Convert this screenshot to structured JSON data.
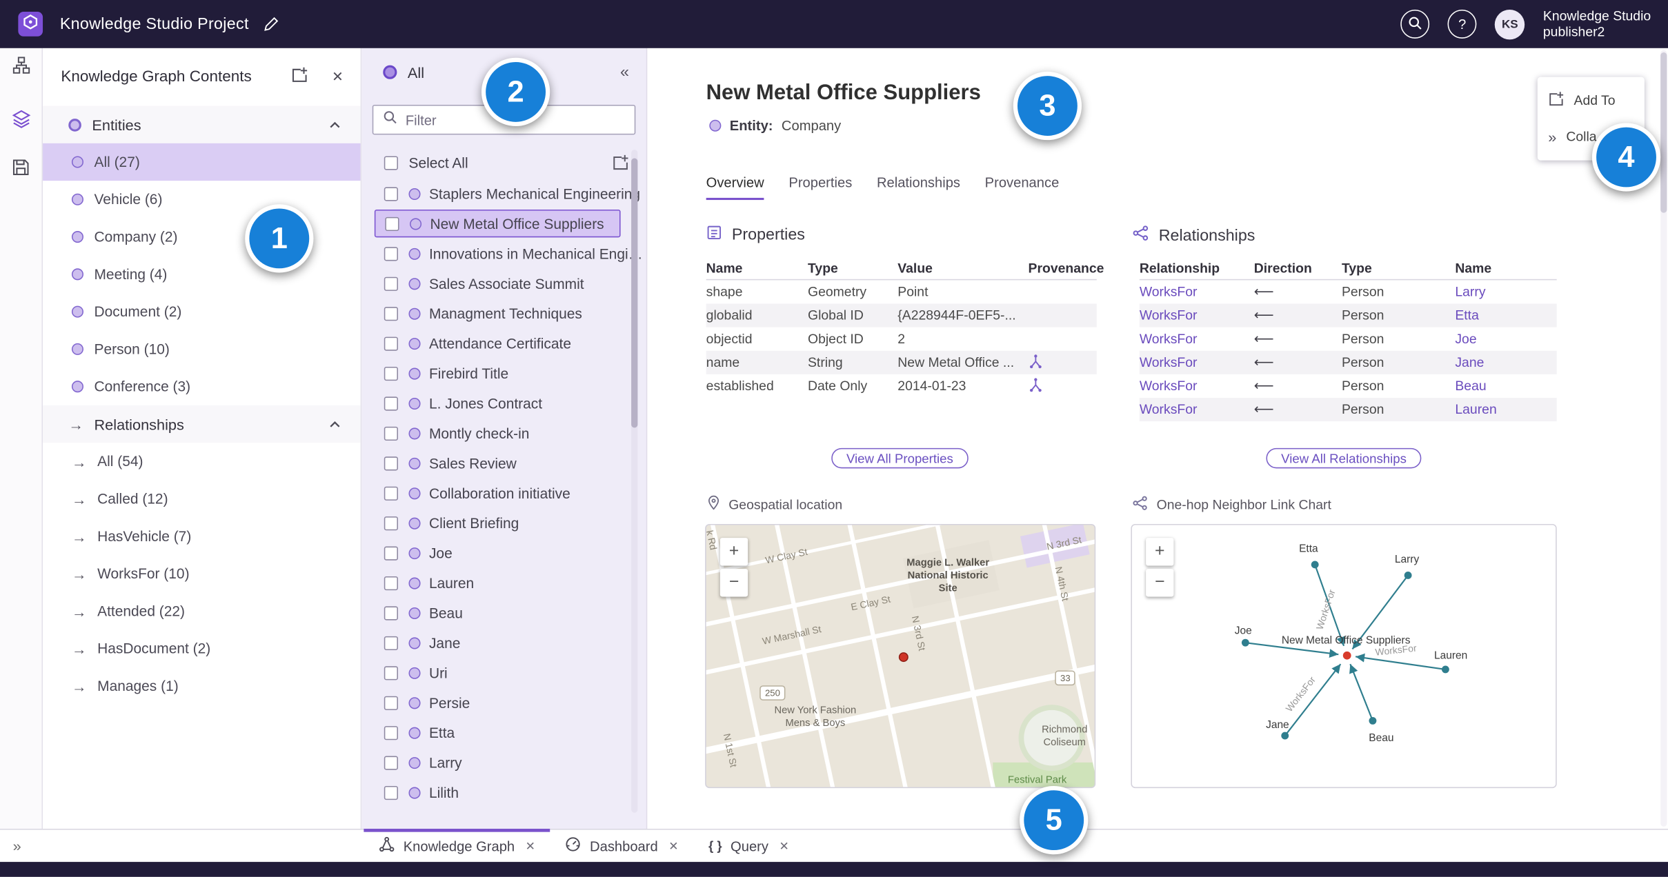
{
  "icons": {
    "close": "✕",
    "collapse_left": "«",
    "expand_right": "»",
    "question": "?",
    "braces": "{ }",
    "plus": "+",
    "minus": "−",
    "arrow_right": "→"
  },
  "topbar": {
    "title": "Knowledge Studio Project",
    "app_name": "Knowledge Studio",
    "user_name": "publisher2",
    "avatar_initials": "KS"
  },
  "contents_panel": {
    "title": "Knowledge Graph Contents",
    "entities": {
      "label": "Entities",
      "items": [
        {
          "label": "All (27)",
          "selected": true
        },
        {
          "label": "Vehicle (6)"
        },
        {
          "label": "Company (2)"
        },
        {
          "label": "Meeting (4)"
        },
        {
          "label": "Document (2)"
        },
        {
          "label": "Person (10)"
        },
        {
          "label": "Conference (3)"
        }
      ]
    },
    "relationships": {
      "label": "Relationships",
      "items": [
        {
          "label": "All (54)"
        },
        {
          "label": "Called (12)"
        },
        {
          "label": "HasVehicle (7)"
        },
        {
          "label": "WorksFor (10)"
        },
        {
          "label": "Attended (22)"
        },
        {
          "label": "HasDocument (2)"
        },
        {
          "label": "Manages (1)"
        }
      ]
    }
  },
  "list_panel": {
    "header": "All",
    "filter_placeholder": "Filter",
    "select_all_label": "Select All",
    "items": [
      {
        "label": "Staplers Mechanical Engineering"
      },
      {
        "label": "New Metal Office Suppliers",
        "selected": true
      },
      {
        "label": "Innovations in Mechanical Engin..."
      },
      {
        "label": "Sales Associate Summit"
      },
      {
        "label": "Managment Techniques"
      },
      {
        "label": "Attendance Certificate"
      },
      {
        "label": "Firebird Title"
      },
      {
        "label": "L. Jones Contract"
      },
      {
        "label": "Montly check-in"
      },
      {
        "label": "Sales Review"
      },
      {
        "label": "Collaboration initiative"
      },
      {
        "label": "Client Briefing"
      },
      {
        "label": "Joe"
      },
      {
        "label": "Lauren"
      },
      {
        "label": "Beau"
      },
      {
        "label": "Jane"
      },
      {
        "label": "Uri"
      },
      {
        "label": "Persie"
      },
      {
        "label": "Etta"
      },
      {
        "label": "Larry"
      },
      {
        "label": "Lilith"
      }
    ]
  },
  "detail": {
    "title": "New Metal Office Suppliers",
    "entity_label": "Entity:",
    "entity_type": "Company",
    "tabs": [
      {
        "label": "Overview",
        "active": true
      },
      {
        "label": "Properties"
      },
      {
        "label": "Relationships"
      },
      {
        "label": "Provenance"
      }
    ],
    "menu": {
      "add_to": "Add To",
      "collapse": "Colla"
    },
    "properties": {
      "heading": "Properties",
      "columns": [
        "Name",
        "Type",
        "Value",
        "Provenance"
      ],
      "rows": [
        {
          "name": "shape",
          "type": "Geometry",
          "value": "Point",
          "provenance": false
        },
        {
          "name": "globalid",
          "type": "Global ID",
          "value": "{A228944F-0EF5-...",
          "provenance": false
        },
        {
          "name": "objectid",
          "type": "Object ID",
          "value": "2",
          "provenance": false
        },
        {
          "name": "name",
          "type": "String",
          "value": "New Metal Office ...",
          "provenance": true
        },
        {
          "name": "established",
          "type": "Date Only",
          "value": "2014-01-23",
          "provenance": true
        }
      ],
      "view_all": "View All Properties"
    },
    "relationships": {
      "heading": "Relationships",
      "columns": [
        "Relationship",
        "Direction",
        "Type",
        "Name"
      ],
      "rows": [
        {
          "relationship": "WorksFor",
          "direction": "⟵",
          "type": "Person",
          "name": "Larry"
        },
        {
          "relationship": "WorksFor",
          "direction": "⟵",
          "type": "Person",
          "name": "Etta"
        },
        {
          "relationship": "WorksFor",
          "direction": "⟵",
          "type": "Person",
          "name": "Joe"
        },
        {
          "relationship": "WorksFor",
          "direction": "⟵",
          "type": "Person",
          "name": "Jane"
        },
        {
          "relationship": "WorksFor",
          "direction": "⟵",
          "type": "Person",
          "name": "Beau"
        },
        {
          "relationship": "WorksFor",
          "direction": "⟵",
          "type": "Person",
          "name": "Lauren"
        }
      ],
      "view_all": "View All Relationships"
    },
    "map": {
      "heading": "Geospatial location",
      "streets": [
        "k Rd",
        "W Clay St",
        "E Clay St",
        "W Marshall St",
        "N 3rd St",
        "N 4th St",
        "N 3rd St",
        "N 1st St"
      ],
      "shields": [
        "250",
        "33"
      ],
      "pois": [
        "Maggie L. Walker National Historic Site",
        "New York Fashion Mens & Boys",
        "Richmond Coliseum",
        "Festival Park"
      ]
    },
    "link_chart": {
      "heading": "One-hop Neighbor Link Chart",
      "center_label": "New Metal Office Suppliers",
      "edge_label": "WorksFor",
      "nodes": [
        "Etta",
        "Larry",
        "Joe",
        "Lauren",
        "Jane",
        "Beau"
      ]
    }
  },
  "bottom_tabs": [
    {
      "label": "Knowledge Graph",
      "active": true
    },
    {
      "label": "Dashboard",
      "active": false
    },
    {
      "label": "Query",
      "active": false
    }
  ],
  "callouts": [
    "1",
    "2",
    "3",
    "4",
    "5"
  ],
  "colors": {
    "accent": "#7a52cc",
    "topbar": "#211c39",
    "callout_blue": "#1780d8",
    "link": "#6a4bbd",
    "edge_teal": "#2f7e8e",
    "center_node_red": "#d83b2b",
    "selected_row": "#d6c6f4"
  }
}
